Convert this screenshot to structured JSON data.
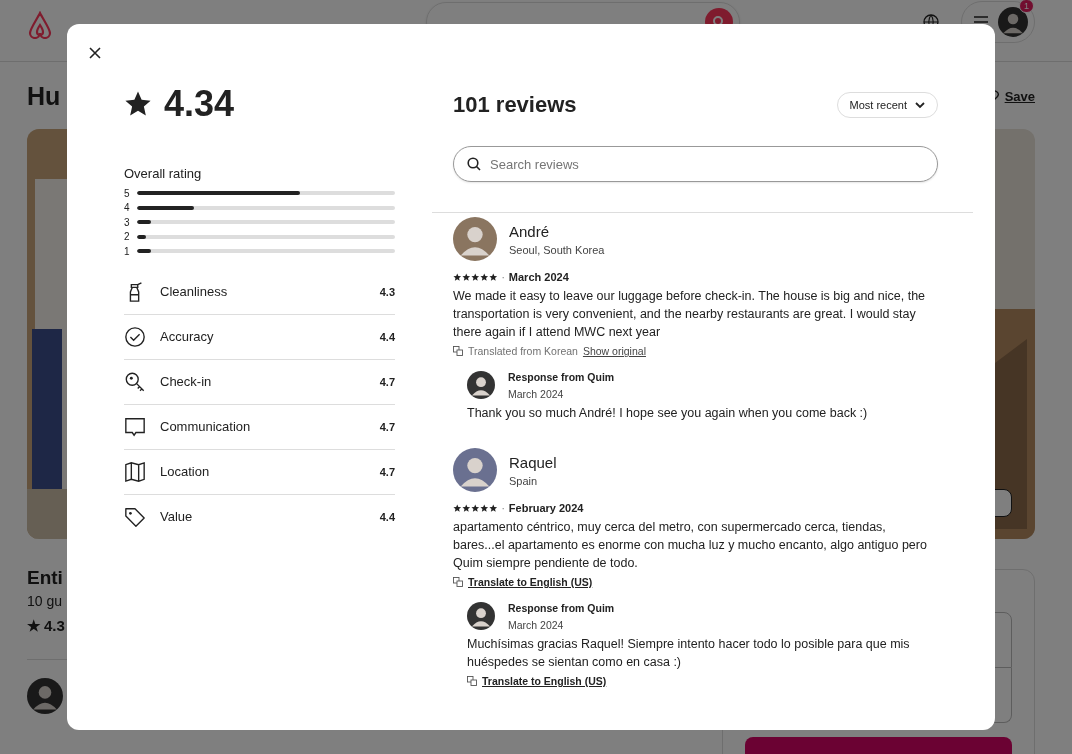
{
  "background": {
    "notification_badge": "1",
    "title": "Hu",
    "save": "Save",
    "listing_title": "Enti",
    "listing_details": "10 gu",
    "listing_star": "★",
    "listing_rating": "4.3"
  },
  "modal": {
    "rating": "4.34",
    "overall_label": "Overall rating",
    "distribution": [
      {
        "label": "5",
        "level": 0.63
      },
      {
        "label": "4",
        "level": 0.22
      },
      {
        "label": "3",
        "level": 0.055
      },
      {
        "label": "2",
        "level": 0.035
      },
      {
        "label": "1",
        "level": 0.055
      }
    ],
    "categories": [
      {
        "kind": "cleanliness",
        "label": "Cleanliness",
        "score": "4.3"
      },
      {
        "kind": "accuracy",
        "label": "Accuracy",
        "score": "4.4"
      },
      {
        "kind": "checkin",
        "label": "Check-in",
        "score": "4.7"
      },
      {
        "kind": "communication",
        "label": "Communication",
        "score": "4.7"
      },
      {
        "kind": "location",
        "label": "Location",
        "score": "4.7"
      },
      {
        "kind": "value",
        "label": "Value",
        "score": "4.4"
      }
    ],
    "reviews_title": "101 reviews",
    "sort": "Most recent",
    "search": {
      "placeholder": "Search reviews"
    },
    "reviews": [
      {
        "name": "André",
        "location": "Seoul, South Korea",
        "stars": 5,
        "separator": "·",
        "date": "March 2024",
        "text": "We made it easy to leave our luggage before check-in. The house is big and nice, the transportation is very convenient, and the nearby restaurants are great. I would stay there again if I attend MWC next year",
        "translation_note": "Translated from Korean",
        "translation_link": "Show original",
        "response": {
          "title": "Response from Quim",
          "date": "March 2024",
          "text": "Thank you so much André! I hope see you again when you come back :)"
        }
      },
      {
        "name": "Raquel",
        "location": "Spain",
        "stars": 5,
        "separator": "·",
        "date": "February 2024",
        "text": "apartamento céntrico, muy cerca del metro, con supermercado cerca, tiendas, bares...el apartamento es enorme con mucha luz y mucho encanto, algo antiguo pero Quim siempre pendiente de todo.",
        "translation_link": "Translate to English (US)",
        "response": {
          "title": "Response from Quim",
          "date": "March 2024",
          "text": "Muchísimas gracias Raquel! Siempre intento hacer todo lo posible para que mis huéspedes se sientan como en casa :)",
          "translation_link": "Translate to English (US)"
        }
      }
    ]
  }
}
